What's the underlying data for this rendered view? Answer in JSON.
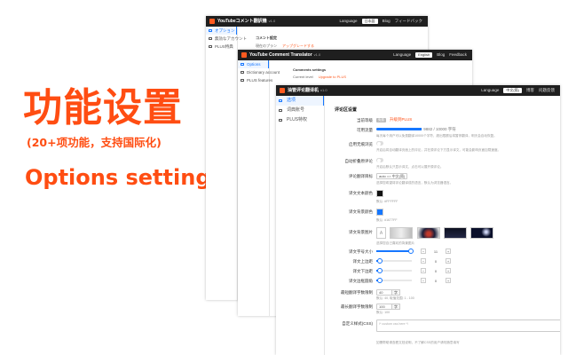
{
  "promo": {
    "title": "功能设置",
    "subtitle": "(20+项功能，支持国际化)",
    "english": "Options setting"
  },
  "window_back": {
    "title": "YouTubeコメント翻訳機",
    "version": "v1.0",
    "language_label": "Language",
    "language_value": "日本語",
    "blog": "Blog",
    "feedback": "フィードバック",
    "sidebar": [
      "オプション",
      "無効なアカウント",
      "PLUS特典"
    ],
    "content_heading": "コメント設定",
    "content_row_label": "現在のプラン",
    "content_row_value": "アップグレードする"
  },
  "window_mid": {
    "title": "YouTube Comment Translator",
    "version": "v1.0",
    "language_label": "Language",
    "language_value": "English",
    "blog": "Blog",
    "feedback": "Feedback",
    "sidebar": [
      "Options",
      "Dictionary account",
      "PLUS features"
    ],
    "content_heading": "Comments settings",
    "content_row_label": "Current level",
    "content_row_value": "Upgrade to PLUS"
  },
  "window_front": {
    "title": "油管评论翻译机",
    "version": "v1.0",
    "language_label": "Language",
    "language_value": "中文(简)",
    "blog": "博客",
    "feedback": "问题反馈",
    "sidebar": [
      "选项",
      "词典账号",
      "PLUS特权"
    ],
    "section_title": "评论区设置",
    "settings": {
      "plan_label": "当前等级",
      "plan_tag": "免费",
      "plan_link": "升级到PLUS",
      "usage_label": "可用流量",
      "usage_value": "9882 / 10000 字符",
      "usage_fraction": 0.99,
      "usage_hint": "每天每个用户可以免费翻译10000个字符，超出限额后将暂停翻译，明天会自动恢复。",
      "auto_label": "启用无痕浏览",
      "auto_hint": "开启后将自动翻译页面上的评论，并在原评论下方显示译文，可能会影响页面加载速度。",
      "original_label": "自动折叠原评论",
      "original_hint": "开启后默认只显示译文，点击可以展开原评论。",
      "lang_label": "评论翻译目标",
      "lang_value": "auto => 中文(简)",
      "lang_hint": "选择您希望将评论翻译成的语言，默认为浏览器语言。",
      "text_color_label": "译文文本颜色",
      "text_color_value": "#FFFFFF",
      "text_color_hint": "默认: #FFFFFF",
      "bg_color_label": "译文背景颜色",
      "bg_color_value": "#1677FF",
      "bg_color_hint": "默认: #1677FF",
      "bg_image_label": "译文背景图片",
      "bg_image_hint": "选择您自己喜欢的背景图片",
      "font_size_label": "译文字号大小",
      "font_size_value": "11",
      "margin_top_label": "译文上边距",
      "margin_top_value": "0",
      "margin_bottom_label": "译文下边距",
      "margin_bottom_value": "0",
      "radius_label": "译文边框圆角",
      "radius_value": "0",
      "min_chars_label": "最短翻译字数限制",
      "min_chars_value": "40",
      "min_chars_unit": "字",
      "min_chars_hint": "默认: 40, 取值范围: 1 - 100",
      "max_chars_label": "最长翻译字数限制",
      "max_chars_value": "100",
      "max_chars_unit": "字",
      "max_chars_hint": "默认: 100",
      "custom_css_label": "自定义样式(CSS)",
      "custom_css_placeholder": "/* custom css here */",
      "custom_css_hint": "如需帮助请查看文档说明，不了解CSS的用户请勿随意填写"
    }
  },
  "colors": {
    "accent": "#ff4d12",
    "primary": "#1677ff",
    "topbar": "#1f1f1f"
  }
}
